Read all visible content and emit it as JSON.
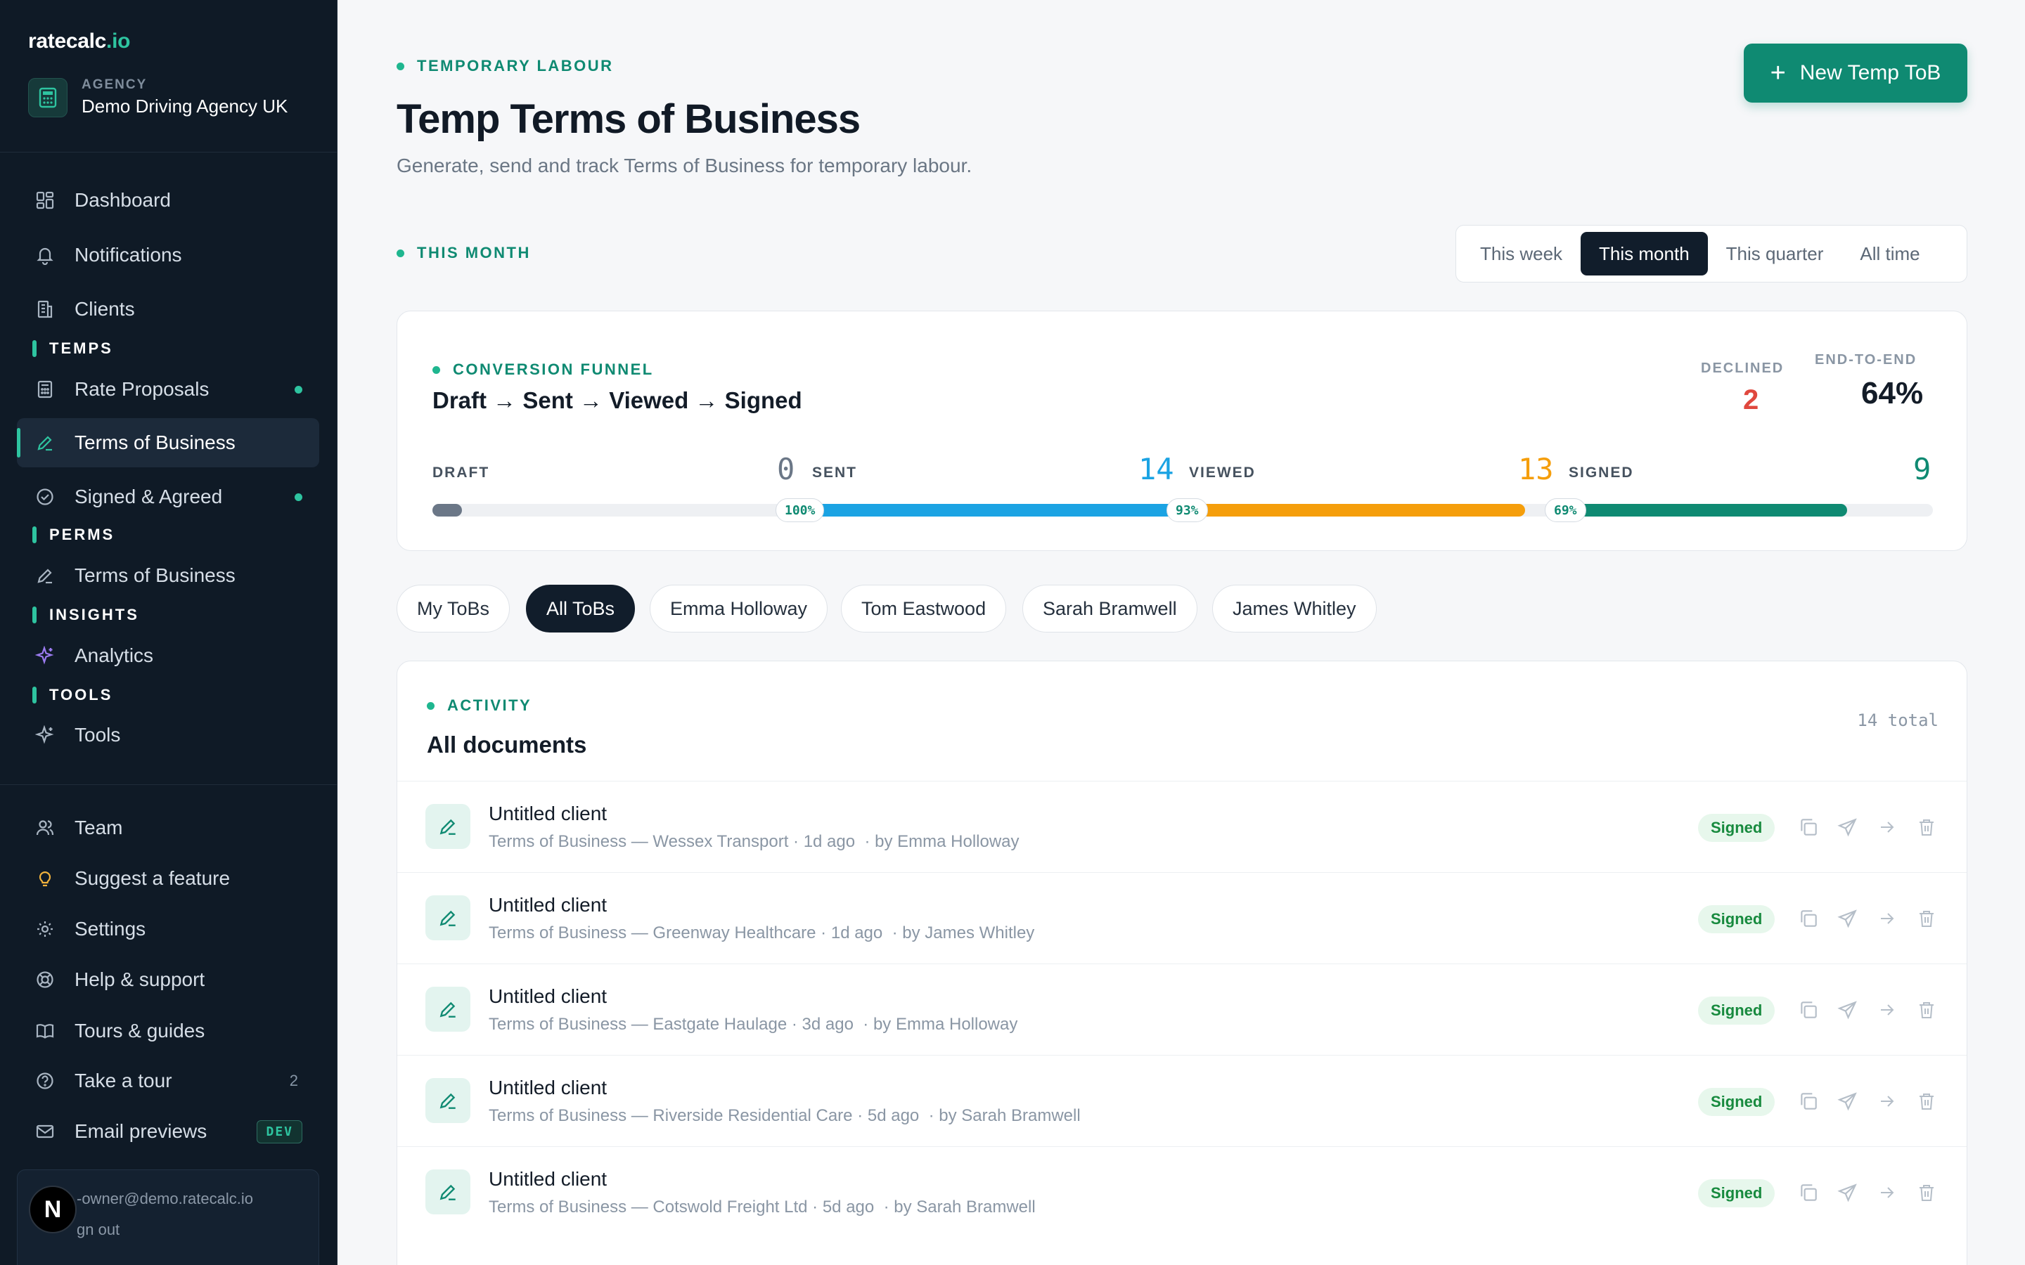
{
  "sidebar": {
    "brand_main": "ratecalc",
    "brand_accent": ".io",
    "agency_label": "AGENCY",
    "agency_name": "Demo Driving Agency UK",
    "items": {
      "dashboard": "Dashboard",
      "notifications": "Notifications",
      "clients": "Clients",
      "rate_proposals": "Rate Proposals",
      "temp_tob": "Terms of Business",
      "signed_agreed": "Signed & Agreed",
      "perm_tob": "Terms of Business",
      "analytics": "Analytics",
      "tools": "Tools",
      "team": "Team",
      "suggest": "Suggest a feature",
      "settings": "Settings",
      "help": "Help & support",
      "tours": "Tours & guides",
      "take_tour": "Take a tour",
      "take_tour_count": "2",
      "email_previews": "Email previews",
      "dev_badge": "DEV"
    },
    "sections": {
      "temps": "TEMPS",
      "perms": "PERMS",
      "insights": "INSIGHTS",
      "tools": "TOOLS"
    },
    "user": {
      "avatar_letter": "N",
      "email": "-owner@demo.ratecalc.io",
      "signout": "gn out"
    }
  },
  "header": {
    "eyebrow": "TEMPORARY LABOUR",
    "title": "Temp Terms of Business",
    "subtitle": "Generate, send and track Terms of Business for temporary labour.",
    "new_button": "New Temp ToB"
  },
  "period": {
    "eyebrow": "THIS MONTH",
    "options": [
      "This week",
      "This month",
      "This quarter",
      "All time"
    ],
    "selected": "This month"
  },
  "funnel": {
    "eyebrow": "CONVERSION FUNNEL",
    "title": "Draft → Sent → Viewed → Signed",
    "declined_label": "DECLINED",
    "declined_value": "2",
    "e2e_label": "END-TO-END",
    "e2e_value": "64%",
    "stages": [
      {
        "label": "DRAFT",
        "count": "0"
      },
      {
        "label": "SENT",
        "count": "14"
      },
      {
        "label": "VIEWED",
        "count": "13"
      },
      {
        "label": "SIGNED",
        "count": "9"
      }
    ],
    "conversions": [
      "100%",
      "93%",
      "69%"
    ],
    "colors": {
      "draft": "#6b7787",
      "sent": "#1ba3e3",
      "viewed": "#f59e0b",
      "signed": "#0f8a72",
      "declined": "#e0483e"
    }
  },
  "filters": [
    "My ToBs",
    "All ToBs",
    "Emma Holloway",
    "Tom Eastwood",
    "Sarah Bramwell",
    "James Whitley"
  ],
  "filters_selected": "All ToBs",
  "activity": {
    "eyebrow": "ACTIVITY",
    "title": "All documents",
    "total": "14 total",
    "rows": [
      {
        "title": "Untitled client",
        "sub": "Terms of Business — Wessex Transport · 1d ago",
        "by": "· by Emma Holloway",
        "status": "Signed"
      },
      {
        "title": "Untitled client",
        "sub": "Terms of Business — Greenway Healthcare · 1d ago",
        "by": "· by James Whitley",
        "status": "Signed"
      },
      {
        "title": "Untitled client",
        "sub": "Terms of Business — Eastgate Haulage · 3d ago",
        "by": "· by Emma Holloway",
        "status": "Signed"
      },
      {
        "title": "Untitled client",
        "sub": "Terms of Business — Riverside Residential Care · 5d ago",
        "by": "· by Sarah Bramwell",
        "status": "Signed"
      },
      {
        "title": "Untitled client",
        "sub": "Terms of Business — Cotswold Freight Ltd · 5d ago",
        "by": "· by Sarah Bramwell",
        "status": "Signed"
      }
    ]
  }
}
